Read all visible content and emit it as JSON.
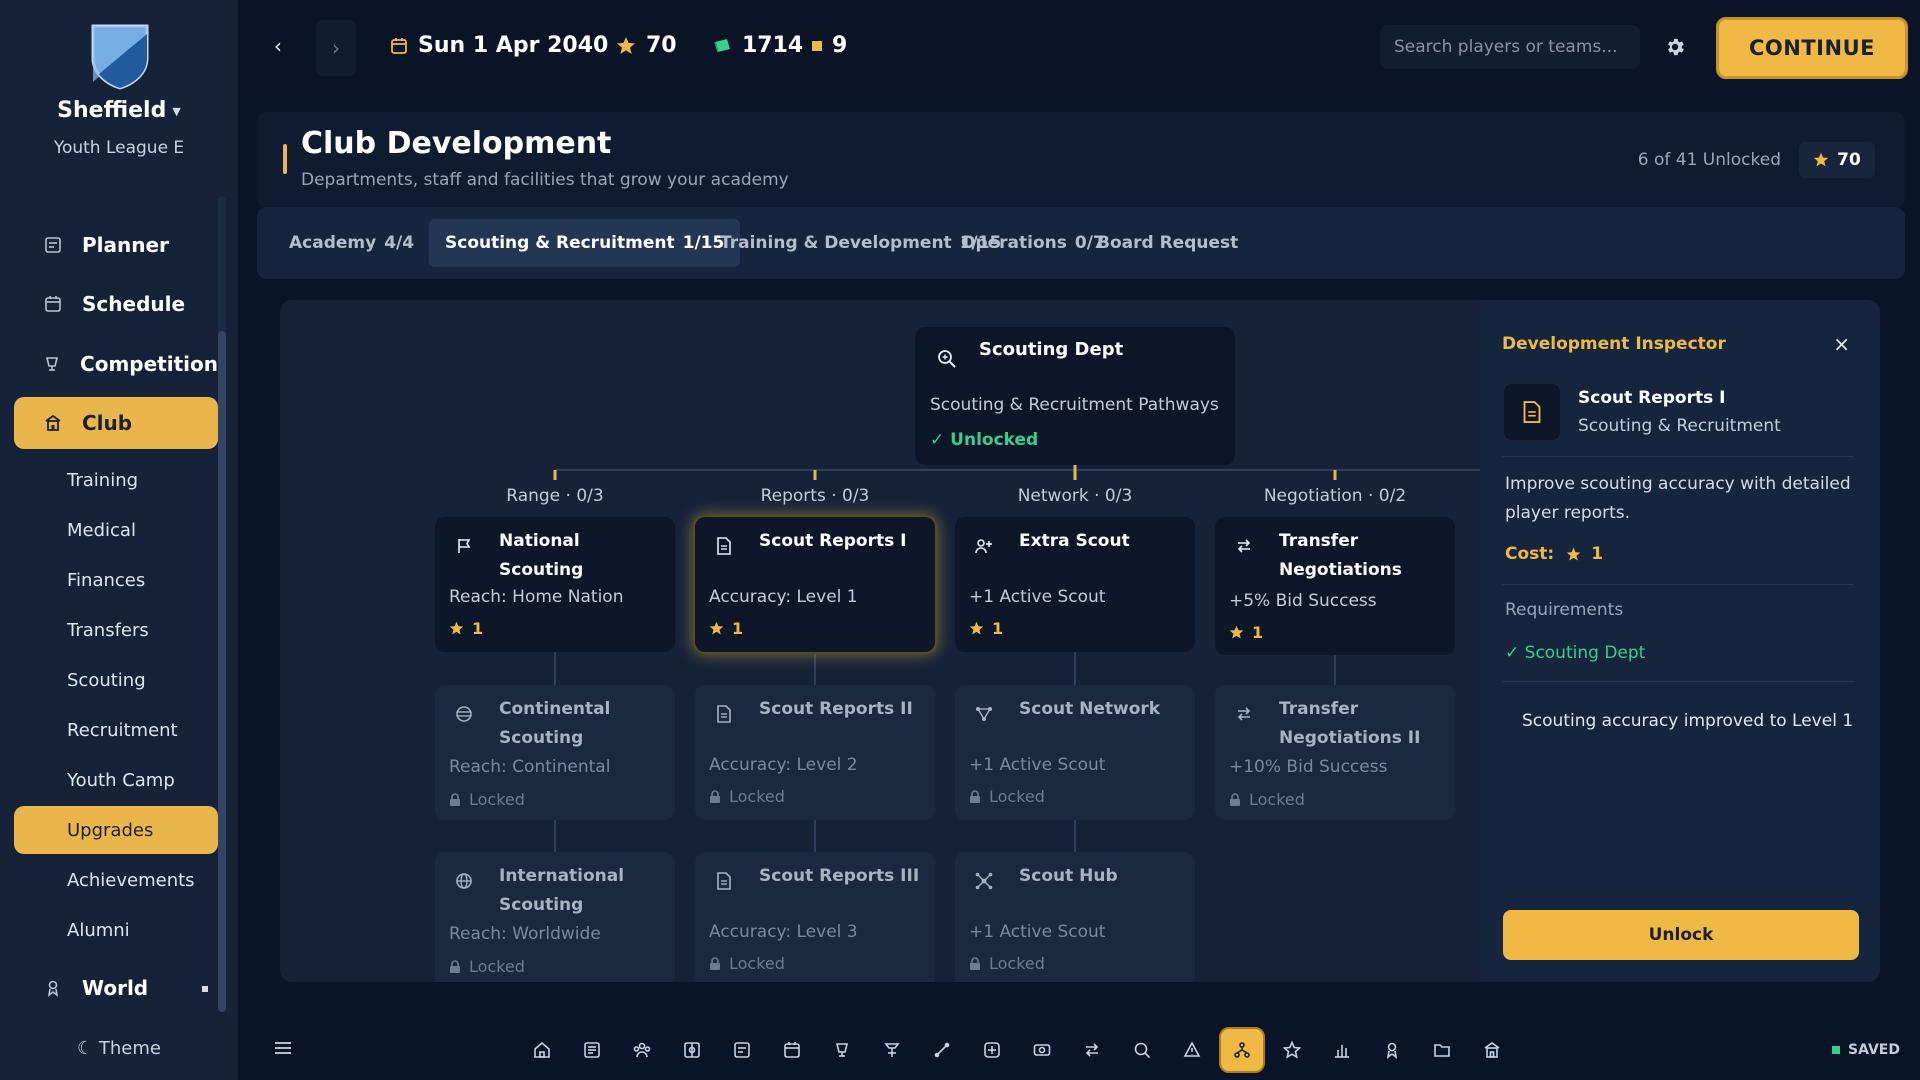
{
  "sidebar": {
    "club_name": "Sheffield",
    "league": "Youth League E",
    "nav": [
      {
        "label": "Planner",
        "icon": "planner-icon"
      },
      {
        "label": "Schedule",
        "icon": "calendar-icon"
      },
      {
        "label": "Competition",
        "icon": "trophy-icon"
      },
      {
        "label": "Club",
        "icon": "building-icon",
        "active": true
      }
    ],
    "sub_nav": [
      "Training",
      "Medical",
      "Finances",
      "Transfers",
      "Scouting",
      "Recruitment",
      "Youth Camp",
      "Upgrades",
      "Achievements",
      "Alumni"
    ],
    "active_sub": "Upgrades",
    "world": {
      "label": "World",
      "icon": "person-icon"
    },
    "theme_label": "☾ Theme"
  },
  "topbar": {
    "back_icon": "‹",
    "forward_icon": "›",
    "date": "Sun 1 Apr 2040",
    "points": "70",
    "currency": "1714",
    "tokens": "9",
    "search_placeholder": "Search players or teams...",
    "continue_label": "CONTINUE"
  },
  "header": {
    "title": "Club Development",
    "subtitle": "Departments, staff and facilities that grow your academy",
    "unlock_count": "6 of 41 Unlocked",
    "points": "70"
  },
  "tabs": [
    {
      "label": "Academy",
      "count": "4/4"
    },
    {
      "label": "Scouting & Recruitment",
      "count": "1/15",
      "active": true
    },
    {
      "label": "Training & Development",
      "count": "1/15"
    },
    {
      "label": "Operations",
      "count": "0/7"
    },
    {
      "label": "Board Request",
      "count": ""
    }
  ],
  "tree": {
    "root": {
      "title": "Scouting Dept",
      "subtitle": "Scouting & Recruitment Pathways",
      "status": "✓ Unlocked",
      "icon": "magnify-icon"
    },
    "branches": [
      {
        "label": "Range · 0/3",
        "nodes": [
          {
            "title": "National Scouting",
            "effect": "Reach: Home Nation",
            "cost": "1",
            "state": "available",
            "icon": "flag-icon"
          },
          {
            "title": "Continental Scouting",
            "effect": "Reach: Continental",
            "cost": "Locked",
            "state": "locked",
            "icon": "globe-lines-icon"
          },
          {
            "title": "International Scouting",
            "effect": "Reach: Worldwide",
            "cost": "Locked",
            "state": "locked",
            "icon": "globe-icon"
          }
        ]
      },
      {
        "label": "Reports · 0/3",
        "nodes": [
          {
            "title": "Scout Reports I",
            "effect": "Accuracy: Level 1",
            "cost": "1",
            "state": "selected",
            "icon": "document-icon"
          },
          {
            "title": "Scout Reports II",
            "effect": "Accuracy: Level 2",
            "cost": "Locked",
            "state": "locked",
            "icon": "document-icon"
          },
          {
            "title": "Scout Reports III",
            "effect": "Accuracy: Level 3",
            "cost": "Locked",
            "state": "locked",
            "icon": "document-icon"
          }
        ]
      },
      {
        "label": "Network · 0/3",
        "nodes": [
          {
            "title": "Extra Scout",
            "effect": "+1 Active Scout",
            "cost": "1",
            "state": "available",
            "icon": "add-person-icon"
          },
          {
            "title": "Scout Network",
            "effect": "+1 Active Scout",
            "cost": "Locked",
            "state": "locked",
            "icon": "network-icon"
          },
          {
            "title": "Scout Hub",
            "effect": "+1 Active Scout",
            "cost": "Locked",
            "state": "locked",
            "icon": "hub-icon"
          }
        ]
      },
      {
        "label": "Negotiation · 0/2",
        "nodes": [
          {
            "title": "Transfer Negotiations",
            "effect": "+5% Bid Success",
            "cost": "1",
            "state": "available",
            "icon": "swap-icon"
          },
          {
            "title": "Transfer Negotiations II",
            "effect": "+10% Bid Success",
            "cost": "Locked",
            "state": "locked",
            "icon": "swap-icon"
          }
        ]
      }
    ]
  },
  "inspector": {
    "title": "Development Inspector",
    "close_label": "×",
    "name": "Scout Reports I",
    "branch": "Scouting & Recruitment",
    "description": "Improve scouting accuracy with detailed player reports.",
    "cost_label": "Cost:",
    "cost": "1",
    "requirements_title": "Requirements",
    "requirement": "✓ Scouting Dept",
    "result": "Scouting accuracy improved to Level 1",
    "unlock_label": "Unlock"
  },
  "bottombar": {
    "dock_icons": [
      "home-icon",
      "news-icon",
      "squad-icon",
      "tactics-icon",
      "planner-icon",
      "calendar-icon",
      "trophy-icon",
      "training-icon",
      "medical-icon",
      "health-plus-icon",
      "finances-icon",
      "transfers-icon",
      "scouting-icon",
      "recruitment-icon",
      "upgrades-icon",
      "star-icon",
      "stats-icon",
      "person-icon",
      "folder-icon",
      "building-icon"
    ],
    "active_dock": "upgrades-icon",
    "saved_label": "SAVED"
  },
  "colors": {
    "accent": "#eab54a",
    "success": "#35d08a",
    "background": "#0a1428",
    "panel": "#152238"
  }
}
